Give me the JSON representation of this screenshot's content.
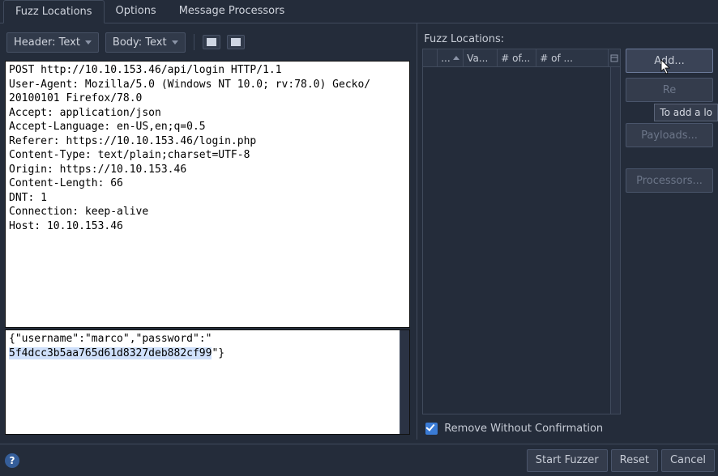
{
  "tabs": {
    "t0": "Fuzz Locations",
    "t1": "Options",
    "t2": "Message Processors"
  },
  "toolbar": {
    "header_view": "Header: Text",
    "body_view": "Body: Text"
  },
  "request": {
    "headers": "POST http://10.10.153.46/api/login HTTP/1.1\nUser-Agent: Mozilla/5.0 (Windows NT 10.0; rv:78.0) Gecko/\n20100101 Firefox/78.0\nAccept: application/json\nAccept-Language: en-US,en;q=0.5\nReferer: https://10.10.153.46/login.php\nContent-Type: text/plain;charset=UTF-8\nOrigin: https://10.10.153.46\nContent-Length: 66\nDNT: 1\nConnection: keep-alive\nHost: 10.10.153.46",
    "body_pre": "{\"username\":\"marco\",\"password\":\"",
    "body_sel": "5f4dcc3b5aa765d61d8327deb882cf99",
    "body_post": "\"}"
  },
  "right": {
    "header": "Fuzz Locations:",
    "cols": {
      "c0": "...",
      "c1": "Va...",
      "c2": "# of...",
      "c3": "# of ..."
    },
    "buttons": {
      "add": "Add...",
      "remove": "Re",
      "payloads": "Payloads...",
      "processors": "Processors..."
    },
    "tooltip": "To add a lo",
    "confirm": "Remove Without Confirmation"
  },
  "footer": {
    "start": "Start Fuzzer",
    "reset": "Reset",
    "cancel": "Cancel"
  }
}
